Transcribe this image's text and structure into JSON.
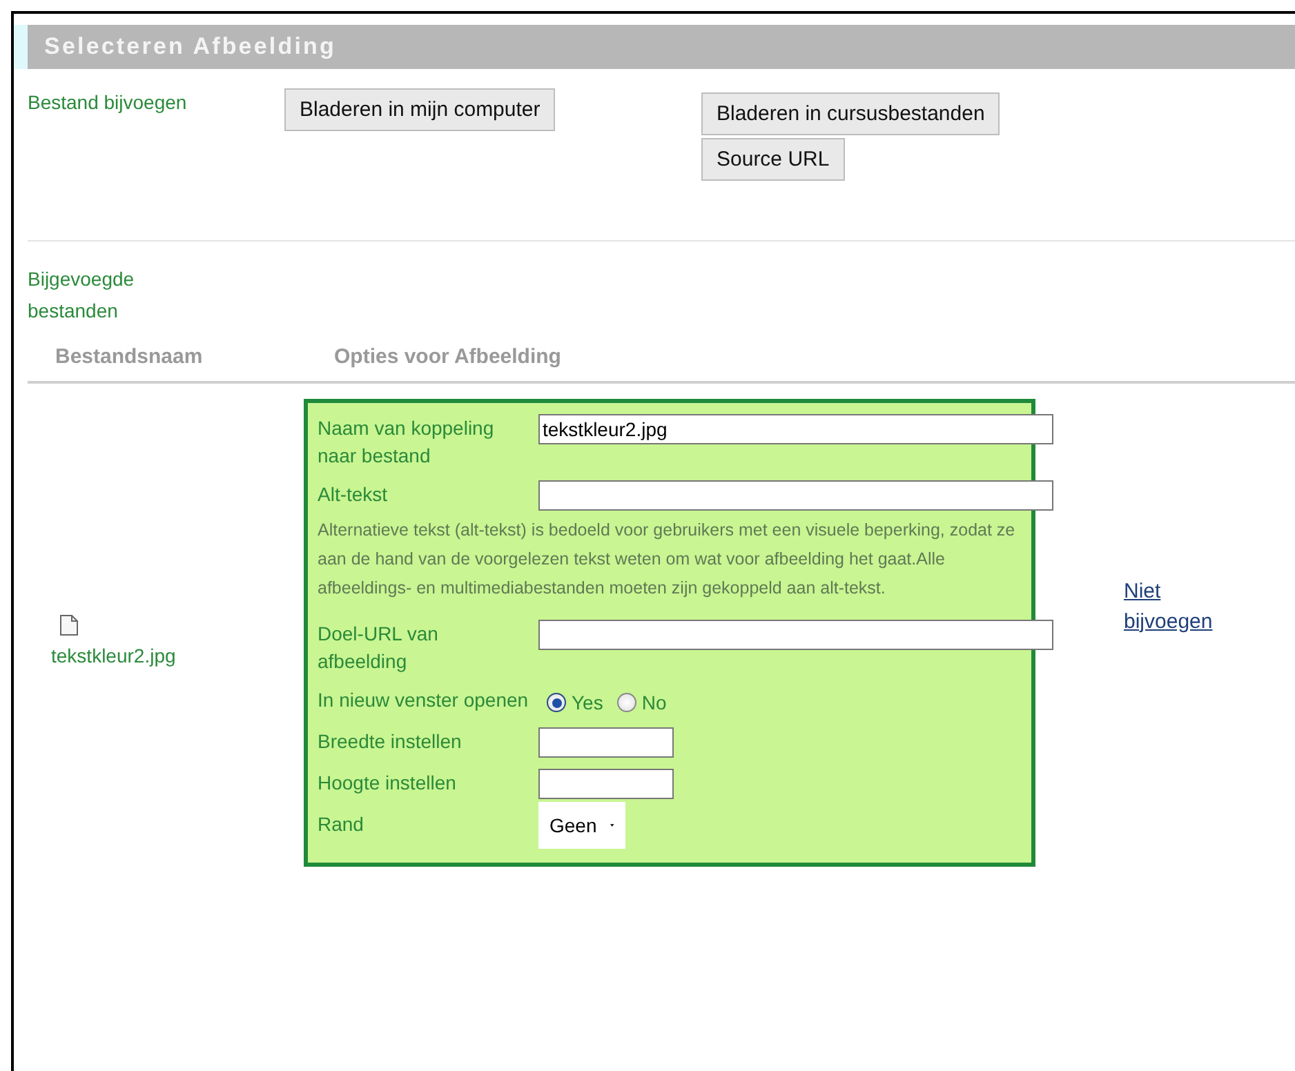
{
  "header": {
    "title": "Selecteren Afbeelding"
  },
  "attach": {
    "label": "Bestand bijvoegen",
    "buttons": [
      "Bladeren in mijn computer",
      "Bladeren in cursusbestanden",
      "Source URL"
    ]
  },
  "attached": {
    "label": "Bijgevoegde bestanden",
    "columns": [
      "Bestandsnaam",
      "Opties voor Afbeelding"
    ],
    "file": {
      "name": "tekstkleur2.jpg"
    },
    "options": [
      {
        "kind": "text",
        "label": "Naam van koppeling naar bestand",
        "value": "tekstkleur2.jpg"
      },
      {
        "kind": "text",
        "label": "Alt-tekst"
      },
      {
        "kind": "note",
        "text": "Alternatieve tekst (alt-tekst) is bedoeld voor gebruikers met een visuele beperking, zodat ze aan de hand van de voorgelezen tekst weten om wat voor afbeelding het gaat.Alle afbeeldings- en multimediabestanden moeten zijn gekoppeld aan alt-tekst."
      },
      {
        "kind": "text",
        "label": "Doel-URL van afbeelding"
      },
      {
        "kind": "radio",
        "label": "In nieuw venster openen",
        "choices": [
          {
            "label": "Yes",
            "selected": true
          },
          {
            "label": "No",
            "selected": false
          }
        ]
      },
      {
        "kind": "short",
        "label": "Breedte instellen"
      },
      {
        "kind": "short",
        "label": "Hoogte instellen"
      },
      {
        "kind": "select",
        "label": "Rand",
        "value": "Geen"
      }
    ],
    "remove_link": "Niet bijvoegen"
  }
}
